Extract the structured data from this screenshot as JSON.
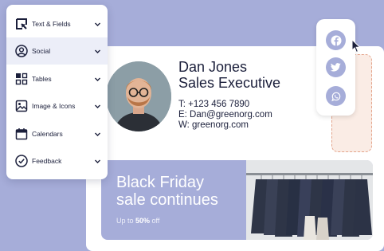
{
  "menu": {
    "items": [
      {
        "label": "Text & Fields",
        "icon": "text-fields-icon"
      },
      {
        "label": "Social",
        "icon": "user-circle-icon",
        "active": true
      },
      {
        "label": "Tables",
        "icon": "table-grid-icon"
      },
      {
        "label": "Image & Icons",
        "icon": "image-icon"
      },
      {
        "label": "Calendars",
        "icon": "calendar-icon"
      },
      {
        "label": "Feedback",
        "icon": "check-circle-icon"
      }
    ]
  },
  "signature": {
    "name": "Dan Jones",
    "title": "Sales Executive",
    "phone": "T: +123 456 7890",
    "email": "E: Dan@greenorg.com",
    "website": "W: greenorg.com"
  },
  "banner": {
    "title_line1": "Black Friday",
    "title_line2": "sale continues",
    "sub_prefix": "Up to ",
    "sub_highlight": "50%",
    "sub_suffix": " off"
  },
  "social": [
    "facebook-icon",
    "twitter-icon",
    "whatsapp-icon"
  ],
  "colors": {
    "background": "#a6add9",
    "accent": "#a6add9",
    "text": "#1b1f3b",
    "dashed_border": "#e4a48b"
  }
}
